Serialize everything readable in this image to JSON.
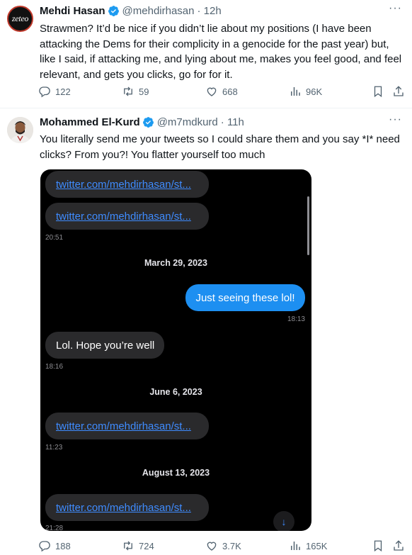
{
  "tweet1": {
    "avatar_text": "zeteo",
    "name": "Mehdi Hasan",
    "handle": "@mehdirhasan",
    "time": "· 12h",
    "text": "Strawmen? It’d be nice if you didn’t lie about my positions (I have been attacking the Dems for their complicity in a genocide for the past year) but, like I said, if attacking me, and lying about me, makes you feel good, and feel relevant, and gets you clicks, go for for it.",
    "replies": "122",
    "reposts": "59",
    "likes": "668",
    "views": "96K"
  },
  "tweet2": {
    "name": "Mohammed El-Kurd",
    "handle": "@m7mdkurd",
    "time": "· 11h",
    "text": "You literally send me your tweets so I could share them and you say *I* need clicks? From you?! You flatter yourself too much",
    "replies": "188",
    "reposts": "724",
    "likes": "3.7K",
    "views": "165K",
    "screenshot": {
      "link1": "twitter.com/mehdirhasan/st...",
      "link2": "twitter.com/mehdirhasan/st...",
      "time1": "20:51",
      "date1": "March 29, 2023",
      "out_msg": "Just seeing these lol!",
      "time2": "18:13",
      "in_msg": "Lol. Hope you’re well",
      "time3": "18:16",
      "date2": "June 6, 2023",
      "link3": "twitter.com/mehdirhasan/st...",
      "time4": "11:23",
      "date3": "August 13, 2023",
      "link4": "twitter.com/mehdirhasan/st...",
      "time5": "21:28"
    }
  },
  "colors": {
    "accent": "#1d9bf0",
    "muted": "#536471",
    "bubble_out": "#1d8ff1",
    "link": "#3f8cff"
  },
  "icons": [
    "reply-icon",
    "repost-icon",
    "like-icon",
    "views-icon",
    "bookmark-icon",
    "share-icon",
    "verified-icon",
    "more-icon",
    "scroll-down-icon"
  ]
}
